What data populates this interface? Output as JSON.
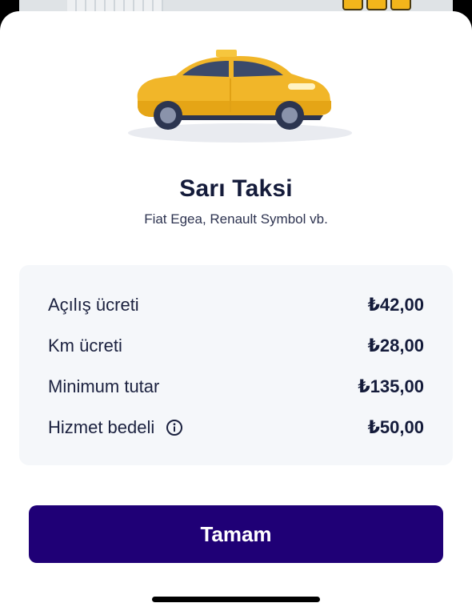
{
  "vehicle": {
    "title": "Sarı Taksi",
    "models": "Fiat Egea, Renault Symbol vb.",
    "color": "#f2b51b"
  },
  "pricing": [
    {
      "label": "Açılış ücreti",
      "value": "₺42,00"
    },
    {
      "label": "Km ücreti",
      "value": "₺28,00"
    },
    {
      "label": "Minimum tutar",
      "value": "₺135,00"
    },
    {
      "label": "Hizmet bedeli",
      "value": "₺50,00",
      "icon": "info-icon"
    }
  ],
  "actions": {
    "confirm_label": "Tamam",
    "confirm_color": "#1f0076"
  }
}
